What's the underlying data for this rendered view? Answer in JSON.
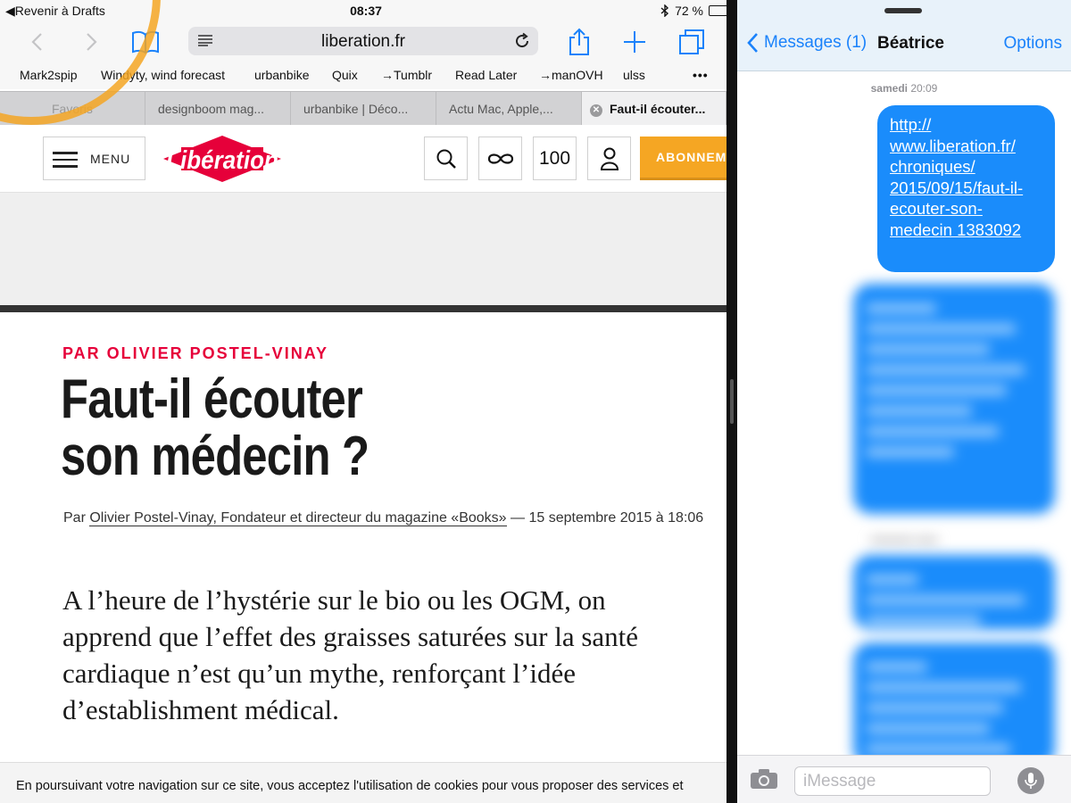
{
  "status": {
    "back_label": "Revenir à Drafts",
    "time": "08:37",
    "battery_text": "72 %",
    "battery_level": 0.72
  },
  "safari": {
    "url": "liberation.fr",
    "bookmarks": [
      "Mark2spip",
      "Windyty, wind forecast",
      "urbanbike",
      "Quix",
      "→Tumblr",
      "Read Later",
      "→manOVH",
      "ulss"
    ],
    "tabs": [
      {
        "title": "Favoris"
      },
      {
        "title": "designboom mag..."
      },
      {
        "title": "urbanbike | Déco..."
      },
      {
        "title": "Actu Mac, Apple,..."
      },
      {
        "title": "Faut-il écouter..."
      }
    ]
  },
  "site": {
    "menu_label": "MENU",
    "logo_text": "Libération",
    "counter": "100",
    "subscribe_label": "ABONNEMENT",
    "colors": {
      "brand_red": "#e6003a",
      "subscribe": "#f5a623"
    }
  },
  "article": {
    "kicker": "PAR OLIVIER POSTEL-VINAY",
    "headline_line1": "Faut-il écouter",
    "headline_line2": "son médecin ?",
    "meta_prefix": "Par",
    "author_link": "Olivier Postel-Vinay, Fondateur et directeur du magazine «Books»",
    "meta_date": "— 15 septembre 2015 à 18:06",
    "lead": "A l’heure de l’hystérie sur le bio ou les OGM, on apprend que l’effet des graisses saturées sur la santé cardiaque n’est qu’un mythe, renforçant l’idée d’establishment médical."
  },
  "cookie_text": "En poursuivant votre navigation sur ce site, vous acceptez l'utilisation de cookies pour vous proposer des services et",
  "messages": {
    "back_label": "Messages (1)",
    "contact": "Béatrice",
    "options_label": "Options",
    "date_day": "samedi",
    "date_time": "20:09",
    "first_message": "http://www.liberation.fr/chroniques/2015/09/15/faut-il-ecouter-son-medecin 1383092",
    "first_message_lines": [
      "http://",
      "www.liberation.fr/",
      "chroniques/",
      "2015/09/15/faut-il-",
      "ecouter-son-",
      "medecin 1383092"
    ],
    "input_placeholder": "iMessage",
    "accent": "#1a8cfb"
  }
}
